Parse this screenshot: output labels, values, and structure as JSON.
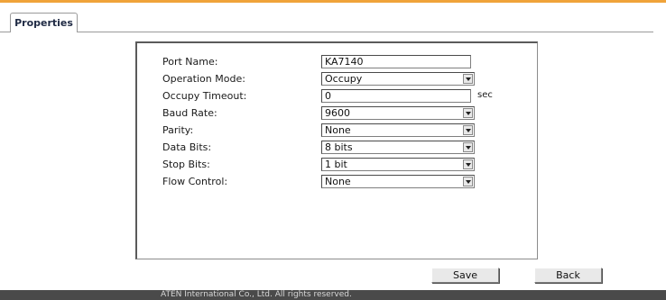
{
  "tabs": [
    {
      "label": "Properties",
      "active": true
    }
  ],
  "form": {
    "fields": [
      {
        "label": "Port Name:",
        "type": "text",
        "value": "KA7140"
      },
      {
        "label": "Operation Mode:",
        "type": "select",
        "value": "Occupy"
      },
      {
        "label": "Occupy Timeout:",
        "type": "text",
        "value": "0",
        "unit": "sec"
      },
      {
        "label": "Baud Rate:",
        "type": "select",
        "value": "9600"
      },
      {
        "label": "Parity:",
        "type": "select",
        "value": "None"
      },
      {
        "label": "Data Bits:",
        "type": "select",
        "value": "8 bits"
      },
      {
        "label": "Stop Bits:",
        "type": "select",
        "value": "1 bit"
      },
      {
        "label": "Flow Control:",
        "type": "select",
        "value": "None"
      }
    ]
  },
  "actions": {
    "save_label": "Save",
    "back_label": "Back"
  },
  "footer": {
    "text": "ATEN International Co., Ltd. All rights reserved."
  },
  "colors": {
    "accent": "#f0a33a",
    "footer_bg": "#4a4a4a"
  }
}
